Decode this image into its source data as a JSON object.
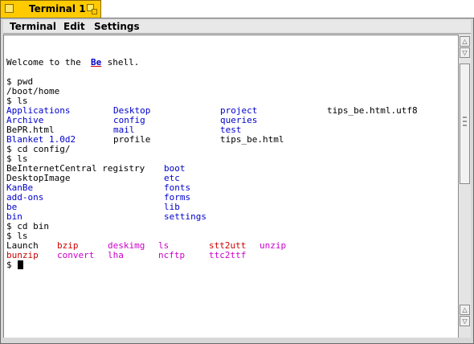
{
  "window": {
    "title": "Terminal 1",
    "icons": [
      "close-icon",
      "zoom-icon"
    ],
    "tab_color": "#ffcb00"
  },
  "menu": [
    "Terminal",
    "Edit",
    "Settings"
  ],
  "colors": {
    "default": "#000000",
    "dir": "#0000cc",
    "exec": "#cc0000",
    "app": "#cc00cc"
  },
  "terminal": {
    "lines": [
      [],
      [
        {
          "t": "Welcome to the ",
          "c": "default"
        },
        {
          "t": "Be",
          "c": "brand"
        },
        {
          "t": " shell.",
          "c": "default"
        }
      ],
      [],
      [
        {
          "t": "$ pwd",
          "c": "default"
        }
      ],
      [
        {
          "t": "/boot/home",
          "c": "default"
        }
      ],
      [
        {
          "t": "$ ls",
          "c": "default"
        }
      ],
      [
        {
          "t": "Applications",
          "c": "dir",
          "col": 0
        },
        {
          "t": "Desktop",
          "c": "dir",
          "col": 19
        },
        {
          "t": "project",
          "c": "dir",
          "col": 38
        },
        {
          "t": "tips_be.html.utf8",
          "c": "default",
          "col": 57
        }
      ],
      [
        {
          "t": "Archive",
          "c": "dir",
          "col": 0
        },
        {
          "t": "config",
          "c": "dir",
          "col": 19
        },
        {
          "t": "queries",
          "c": "dir",
          "col": 38
        }
      ],
      [
        {
          "t": "BePR.html",
          "c": "default",
          "col": 0
        },
        {
          "t": "mail",
          "c": "dir",
          "col": 19
        },
        {
          "t": "test",
          "c": "dir",
          "col": 38
        }
      ],
      [
        {
          "t": "Blanket 1.0d2",
          "c": "dir",
          "col": 0
        },
        {
          "t": "profile",
          "c": "default",
          "col": 19
        },
        {
          "t": "tips_be.html",
          "c": "default",
          "col": 38
        }
      ],
      [
        {
          "t": "$ cd config/",
          "c": "default"
        }
      ],
      [
        {
          "t": "$ ls",
          "c": "default"
        }
      ],
      [
        {
          "t": "BeInternetCentral registry",
          "c": "default",
          "col": 0
        },
        {
          "t": "boot",
          "c": "dir",
          "col": 28
        }
      ],
      [
        {
          "t": "DesktopImage",
          "c": "default",
          "col": 0
        },
        {
          "t": "etc",
          "c": "dir",
          "col": 28
        }
      ],
      [
        {
          "t": "KanBe",
          "c": "dir",
          "col": 0
        },
        {
          "t": "fonts",
          "c": "dir",
          "col": 28
        }
      ],
      [
        {
          "t": "add-ons",
          "c": "dir",
          "col": 0
        },
        {
          "t": "forms",
          "c": "dir",
          "col": 28
        }
      ],
      [
        {
          "t": "be",
          "c": "dir",
          "col": 0
        },
        {
          "t": "lib",
          "c": "dir",
          "col": 28
        }
      ],
      [
        {
          "t": "bin",
          "c": "dir",
          "col": 0
        },
        {
          "t": "settings",
          "c": "dir",
          "col": 28
        }
      ],
      [
        {
          "t": "$ cd bin",
          "c": "default"
        }
      ],
      [
        {
          "t": "$ ls",
          "c": "default"
        }
      ],
      [
        {
          "t": "Launch",
          "c": "default",
          "col": 0
        },
        {
          "t": "bzip",
          "c": "exec",
          "col": 9
        },
        {
          "t": "deskimg",
          "c": "app",
          "col": 18
        },
        {
          "t": "ls",
          "c": "app",
          "col": 27
        },
        {
          "t": "stt2utt",
          "c": "exec",
          "col": 36
        },
        {
          "t": "unzip",
          "c": "app",
          "col": 45
        }
      ],
      [
        {
          "t": "bunzip",
          "c": "exec",
          "col": 0
        },
        {
          "t": "convert",
          "c": "app",
          "col": 9
        },
        {
          "t": "lha",
          "c": "app",
          "col": 18
        },
        {
          "t": "ncftp",
          "c": "app",
          "col": 27
        },
        {
          "t": "ttc2ttf",
          "c": "app",
          "col": 36
        }
      ],
      [
        {
          "t": "$ ",
          "c": "default",
          "cursor": true
        }
      ]
    ]
  },
  "scrollbar": {
    "up_icon": "arrow-up-icon",
    "down_icon": "arrow-down-icon",
    "position": 0.08
  }
}
